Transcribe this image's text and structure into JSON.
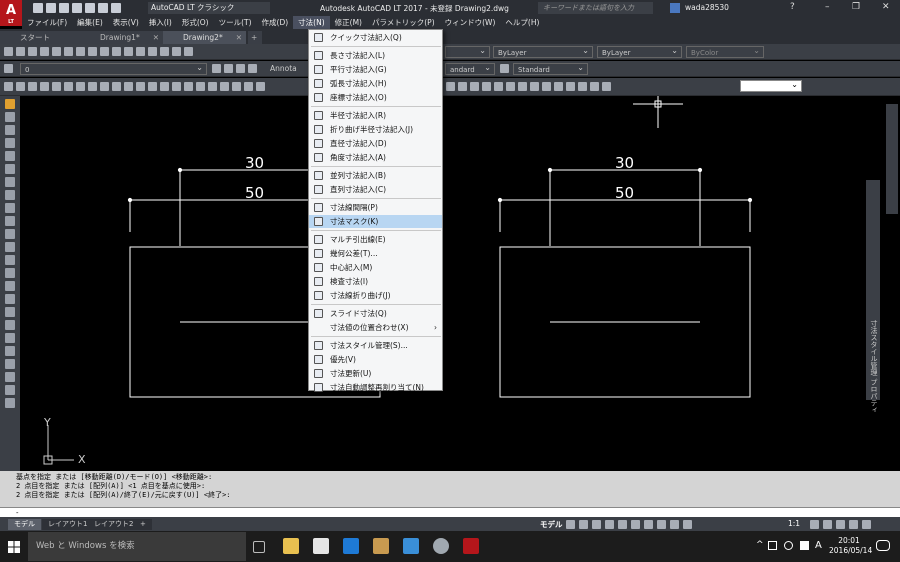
{
  "app": {
    "logo": "A",
    "logo_sub": "LT",
    "workspace": "AutoCAD LT クラシック",
    "title": "Autodesk AutoCAD LT 2017 - 未登録    Drawing2.dwg",
    "search_placeholder": "キーワードまたは語句を入力",
    "user": "wada28530"
  },
  "menubar": {
    "items": [
      {
        "label": "ファイル(F)"
      },
      {
        "label": "編集(E)"
      },
      {
        "label": "表示(V)"
      },
      {
        "label": "挿入(I)"
      },
      {
        "label": "形式(O)"
      },
      {
        "label": "ツール(T)"
      },
      {
        "label": "作成(D)"
      },
      {
        "label": "寸法(N)"
      },
      {
        "label": "修正(M)"
      },
      {
        "label": "パラメトリック(P)"
      },
      {
        "label": "ウィンドウ(W)"
      },
      {
        "label": "ヘルプ(H)"
      }
    ]
  },
  "tabs": {
    "start": "スタート",
    "drawing1": "Drawing1*",
    "drawing2": "Drawing2*",
    "add": "+"
  },
  "toolbars": {
    "layer_value": "0",
    "annotative": "Annota",
    "text_style": "Standard",
    "dim_style": "Standard",
    "dim_style_left": "andard",
    "linetype": "ByLayer",
    "lineweight": "ByLayer",
    "color": "ByColor"
  },
  "dimension_menu": {
    "items": [
      {
        "label": "クイック寸法記入(Q)",
        "icon": "quick-dim-icon"
      },
      {
        "label": "長さ寸法記入(L)",
        "icon": "linear-dim-icon"
      },
      {
        "label": "平行寸法記入(G)",
        "icon": "aligned-dim-icon"
      },
      {
        "label": "弧長寸法記入(H)",
        "icon": "arc-length-icon"
      },
      {
        "label": "座標寸法記入(O)",
        "icon": "ordinate-icon"
      },
      {
        "label": "半径寸法記入(R)",
        "icon": "radius-icon"
      },
      {
        "label": "折り曲げ半径寸法記入(J)",
        "icon": "jogged-radius-icon"
      },
      {
        "label": "直径寸法記入(D)",
        "icon": "diameter-icon"
      },
      {
        "label": "角度寸法記入(A)",
        "icon": "angular-icon"
      },
      {
        "label": "並列寸法記入(B)",
        "icon": "baseline-icon"
      },
      {
        "label": "直列寸法記入(C)",
        "icon": "continue-icon"
      },
      {
        "label": "寸法線間隔(P)",
        "icon": "dim-space-icon"
      },
      {
        "label": "寸法マスク(K)",
        "icon": "dim-break-icon"
      },
      {
        "label": "マルチ引出線(E)",
        "icon": "multileader-icon"
      },
      {
        "label": "幾何公差(T)...",
        "icon": "tolerance-icon"
      },
      {
        "label": "中心記入(M)",
        "icon": "center-mark-icon"
      },
      {
        "label": "検査寸法(I)",
        "icon": "inspection-icon"
      },
      {
        "label": "寸法線折り曲げ(J)",
        "icon": "jogged-linear-icon"
      },
      {
        "label": "スライド寸法(Q)",
        "icon": "oblique-icon"
      },
      {
        "label": "寸法値の位置合わせ(X)",
        "icon": ""
      },
      {
        "label": "寸法スタイル管理(S)...",
        "icon": "dim-style-icon"
      },
      {
        "label": "優先(V)",
        "icon": "override-icon"
      },
      {
        "label": "寸法更新(U)",
        "icon": "update-icon"
      },
      {
        "label": "寸法自動調整再割り当て(N)",
        "icon": "reassociate-icon"
      }
    ],
    "highlighted": "寸法マスク(K)",
    "submenu_arrow": "›"
  },
  "drawing": {
    "left_dim_top": "30",
    "left_dim_bottom": "50",
    "right_dim_top": "30",
    "right_dim_bottom": "50",
    "ucs_y": "Y",
    "ucs_x": "X"
  },
  "command": {
    "lines": [
      "基点を指定 または [移動距離(D)/モード(O)] <移動距離>:",
      "2 点目を指定 または [配列(A)] <1 点目を基点に使用>:",
      "2 点目を指定 または [配列(A)/終了(E)/元に戻す(U)] <終了>:"
    ],
    "prompt": "-"
  },
  "layout": {
    "model": "モデル",
    "layout1": "レイアウト1",
    "layout2": "レイアウト2",
    "add": "+",
    "status_model": "モデル",
    "scale": "1:1"
  },
  "side_panel": {
    "label": "寸法スタイル管理 プロパティ"
  },
  "taskbar": {
    "search": "Web と Windows を検索",
    "ime": "A",
    "time": "20:01",
    "date": "2016/05/14"
  },
  "colors": {
    "accent_red": "#b5161b",
    "menu_highlight": "#b8d6f2",
    "canvas": "#000000"
  }
}
